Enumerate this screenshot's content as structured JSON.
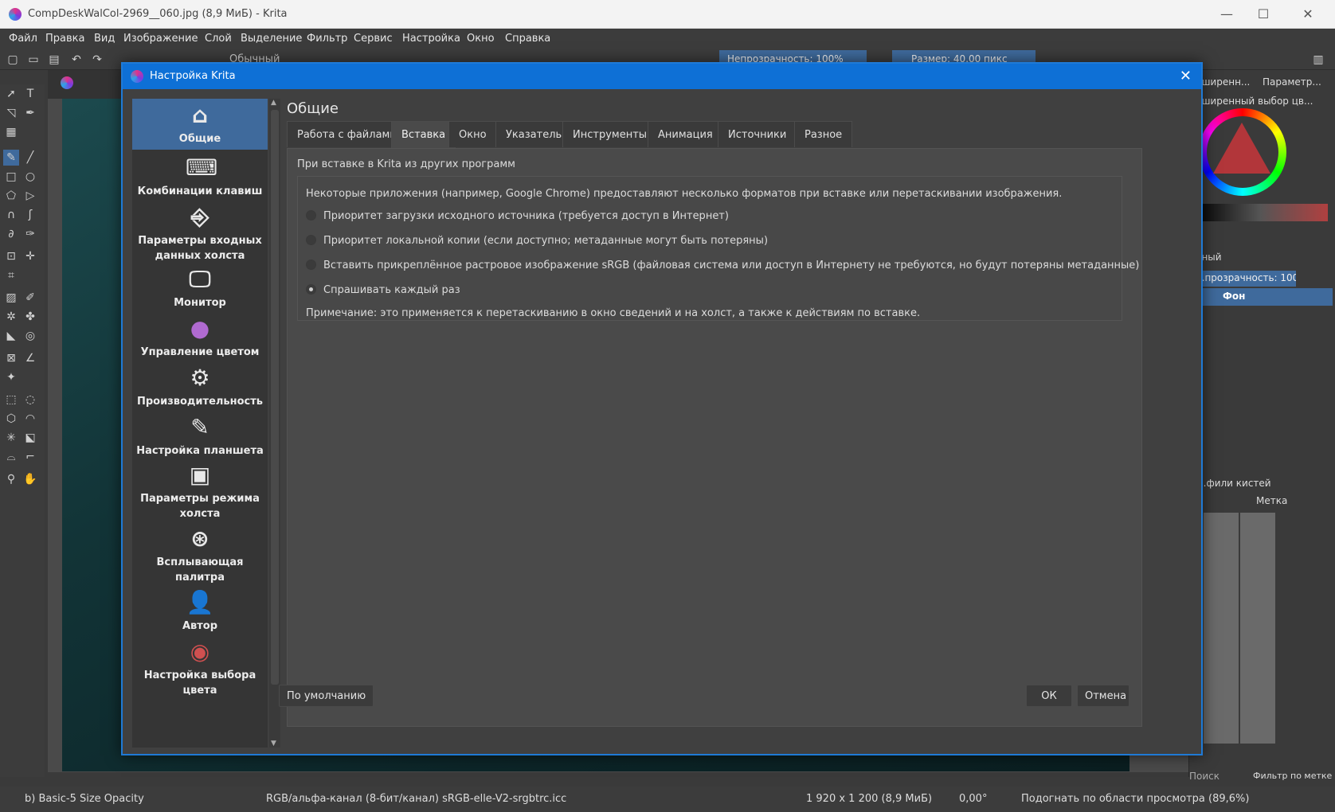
{
  "window": {
    "title": "CompDeskWalCol-2969__060.jpg (8,9 МиБ)  - Krita",
    "minimize": "—",
    "maximize": "☐",
    "close": "✕"
  },
  "menu": [
    "Файл",
    "Правка",
    "Вид",
    "Изображение",
    "Слой",
    "Выделение",
    "Фильтр",
    "Сервис",
    "Настройка",
    "Окно",
    "Справка"
  ],
  "toolbar": {
    "blend_mode": "Обычный",
    "opacity": "Непрозрачность: 100%",
    "size": "Размер: 40,00 пикс"
  },
  "right_dock": {
    "tab1": "...ширенн...",
    "tab2": "Параметр...",
    "color_panel_title": "...ширенный выбор цв...",
    "layer_blend": "...ный",
    "layer_opacity": "...прозрачность: 100%",
    "layer_name": "Фон",
    "brush_panel_title": "...фили кистей",
    "tag_label": "Метка",
    "search_label": "Поиск",
    "filter_label": "Фильтр по метке"
  },
  "dialog": {
    "title": "Настройка Krita",
    "page_title": "Общие",
    "sidebar": [
      {
        "icon": "home-icon",
        "label": "Общие",
        "glyph": "⌂"
      },
      {
        "icon": "keyboard-icon",
        "label": "Комбинации клавиш",
        "glyph": "⌨"
      },
      {
        "icon": "input-settings-icon",
        "label": "Параметры входных данных холста",
        "glyph": "⎆"
      },
      {
        "icon": "monitor-icon",
        "label": "Монитор",
        "glyph": "🖵"
      },
      {
        "icon": "color-management-icon",
        "label": "Управление цветом",
        "glyph": "●"
      },
      {
        "icon": "performance-gear-icon",
        "label": "Производительность",
        "glyph": "⚙"
      },
      {
        "icon": "tablet-icon",
        "label": "Настройка планшета",
        "glyph": "✎"
      },
      {
        "icon": "canvas-mode-icon",
        "label": "Параметры режима холста",
        "glyph": "▣"
      },
      {
        "icon": "popup-palette-icon",
        "label": "Всплывающая палитра",
        "glyph": "⊛"
      },
      {
        "icon": "author-icon",
        "label": "Автор",
        "glyph": "👤"
      },
      {
        "icon": "color-selector-icon",
        "label": "Настройка выбора цвета",
        "glyph": "◉"
      }
    ],
    "tabs": [
      "Работа с файлами",
      "Вставка",
      "Окно",
      "Указатель",
      "Инструменты",
      "Анимация",
      "Источники",
      "Разное"
    ],
    "active_tab": "Вставка",
    "group_title": "При вставке в Krita из других программ",
    "intro": "Некоторые приложения (например, Google Chrome) предоставляют несколько форматов при вставке или перетаскивании изображения.",
    "options": [
      "Приоритет загрузки исходного источника (требуется доступ в Интернет)",
      "Приоритет локальной копии (если доступно; метаданные могут быть потеряны)",
      "Вставить прикреплённое растровое изображение sRGB (файловая система или доступ в Интернету не требуются, но будут потеряны метаданные)",
      "Спрашивать каждый раз"
    ],
    "selected_option": 3,
    "note": "Примечание: это применяется к перетаскиванию в окно сведений и на холст, а также к действиям по вставке.",
    "defaults_button": "По умолчанию",
    "ok_button": "ОК",
    "cancel_button": "Отмена"
  },
  "status": {
    "brush": "b) Basic-5 Size Opacity",
    "color_space": "RGB/альфа-канал (8-бит/канал)  sRGB-elle-V2-srgbtrc.icc",
    "image_size": "1 920 x 1 200 (8,9 МиБ)",
    "rotation": "0,00°",
    "zoom": "Подогнать по области просмотра (89,6%)"
  },
  "colors": {
    "dialog_title_bg": "#0e70d6",
    "sidebar_active": "#3f6a9c",
    "window_bg": "#3a3a3a"
  }
}
